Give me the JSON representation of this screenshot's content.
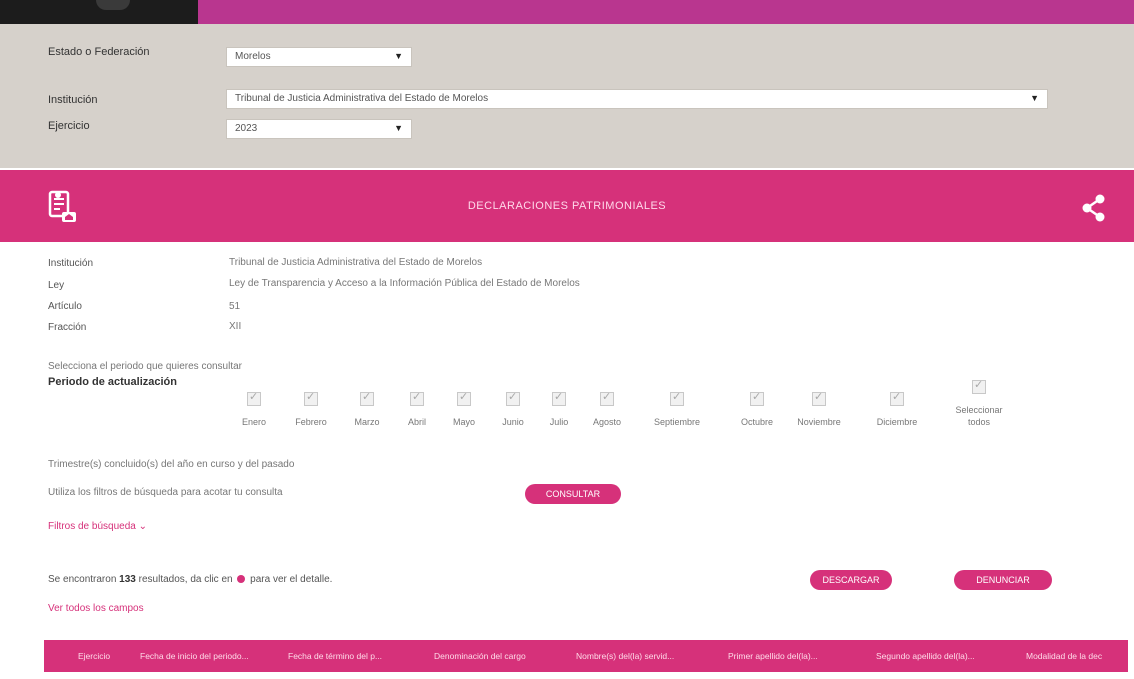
{
  "filters": {
    "estado_label": "Estado o Federación",
    "estado_value": "Morelos",
    "institucion_label": "Institución",
    "institucion_value": "Tribunal de Justicia Administrativa del Estado de Morelos",
    "ejercicio_label": "Ejercicio",
    "ejercicio_value": "2023"
  },
  "banner": {
    "title": "DECLARACIONES PATRIMONIALES"
  },
  "info": {
    "institucion_label": "Institución",
    "institucion_value": "Tribunal de Justicia Administrativa del Estado de Morelos",
    "ley_label": "Ley",
    "ley_value": "Ley de Transparencia y Acceso a la Información Pública del Estado de Morelos",
    "articulo_label": "Artículo",
    "articulo_value": "51",
    "fraccion_label": "Fracción",
    "fraccion_value": "XII"
  },
  "period": {
    "instruction": "Selecciona el periodo que quieres consultar",
    "label": "Periodo de actualización",
    "months": [
      "Enero",
      "Febrero",
      "Marzo",
      "Abril",
      "Mayo",
      "Junio",
      "Julio",
      "Agosto",
      "Septiembre",
      "Octubre",
      "Noviembre",
      "Diciembre"
    ],
    "select_all_line1": "Seleccionar",
    "select_all_line2": "todos"
  },
  "notes": {
    "trimestre": "Trimestre(s) concluido(s) del año en curso y del pasado",
    "filters_hint": "Utiliza los filtros de búsqueda para acotar tu consulta",
    "consultar_button": "CONSULTAR",
    "filters_link": "Filtros de búsqueda"
  },
  "results": {
    "prefix": "Se encontraron",
    "count": "133",
    "middle": "resultados, da clic en",
    "suffix": "para ver el detalle.",
    "download_button": "DESCARGAR",
    "denounce_button": "DENUNCIAR",
    "all_fields_link": "Ver todos los campos"
  },
  "table": {
    "columns": [
      "Ejercicio",
      "Fecha de inicio del periodo...",
      "Fecha de término del p...",
      "Denominación del cargo",
      "Nombre(s) del(la) servid...",
      "Primer apellido del(la)...",
      "Segundo apellido del(la)...",
      "Modalidad de la dec"
    ]
  }
}
